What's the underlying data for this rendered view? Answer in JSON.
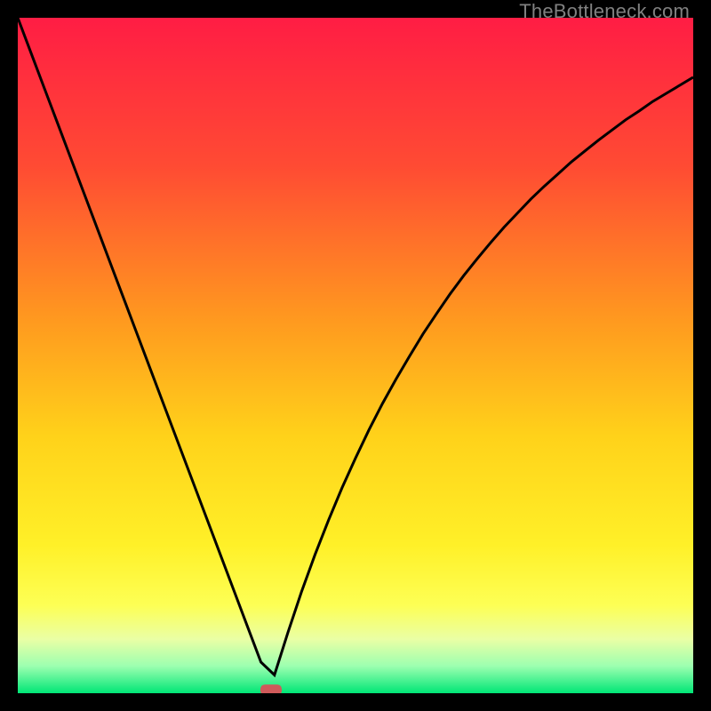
{
  "watermark": "TheBottleneck.com",
  "chart_data": {
    "type": "line",
    "title": "",
    "xlabel": "",
    "ylabel": "",
    "xlim": [
      0,
      100
    ],
    "ylim": [
      0,
      100
    ],
    "curve_x": [
      0,
      2,
      4,
      6,
      8,
      10,
      12,
      14,
      16,
      18,
      20,
      22,
      24,
      26,
      28,
      30,
      32,
      34,
      36,
      38,
      40,
      42,
      44,
      46,
      48,
      50,
      52,
      54,
      56,
      58,
      60,
      62,
      64,
      66,
      68,
      70,
      72,
      74,
      76,
      78,
      80,
      82,
      84,
      86,
      88,
      90,
      92,
      94,
      96,
      98,
      100
    ],
    "curve_y": [
      100,
      94.7,
      89.4,
      84.1,
      78.8,
      73.5,
      68.2,
      62.9,
      57.6,
      52.3,
      47.0,
      41.7,
      36.4,
      31.1,
      25.8,
      20.5,
      15.2,
      9.9,
      4.6,
      2.7,
      9.0,
      15.0,
      20.5,
      25.6,
      30.4,
      34.8,
      39.0,
      42.9,
      46.5,
      49.9,
      53.2,
      56.2,
      59.1,
      61.8,
      64.3,
      66.7,
      69.0,
      71.1,
      73.2,
      75.1,
      76.9,
      78.7,
      80.3,
      81.9,
      83.4,
      84.9,
      86.2,
      87.6,
      88.8,
      90.0,
      91.2
    ],
    "marker": {
      "x": 37.5,
      "y": 0.5,
      "color": "#cf5a5a"
    },
    "gradient_stops": [
      {
        "offset": 0.0,
        "color": "#ff1d44"
      },
      {
        "offset": 0.22,
        "color": "#ff4b33"
      },
      {
        "offset": 0.45,
        "color": "#ff9a1f"
      },
      {
        "offset": 0.62,
        "color": "#ffd21a"
      },
      {
        "offset": 0.78,
        "color": "#fff028"
      },
      {
        "offset": 0.87,
        "color": "#fdff55"
      },
      {
        "offset": 0.92,
        "color": "#eaffa5"
      },
      {
        "offset": 0.96,
        "color": "#9cffb0"
      },
      {
        "offset": 1.0,
        "color": "#00e676"
      }
    ],
    "curve_color": "#000000",
    "curve_width": 3
  }
}
